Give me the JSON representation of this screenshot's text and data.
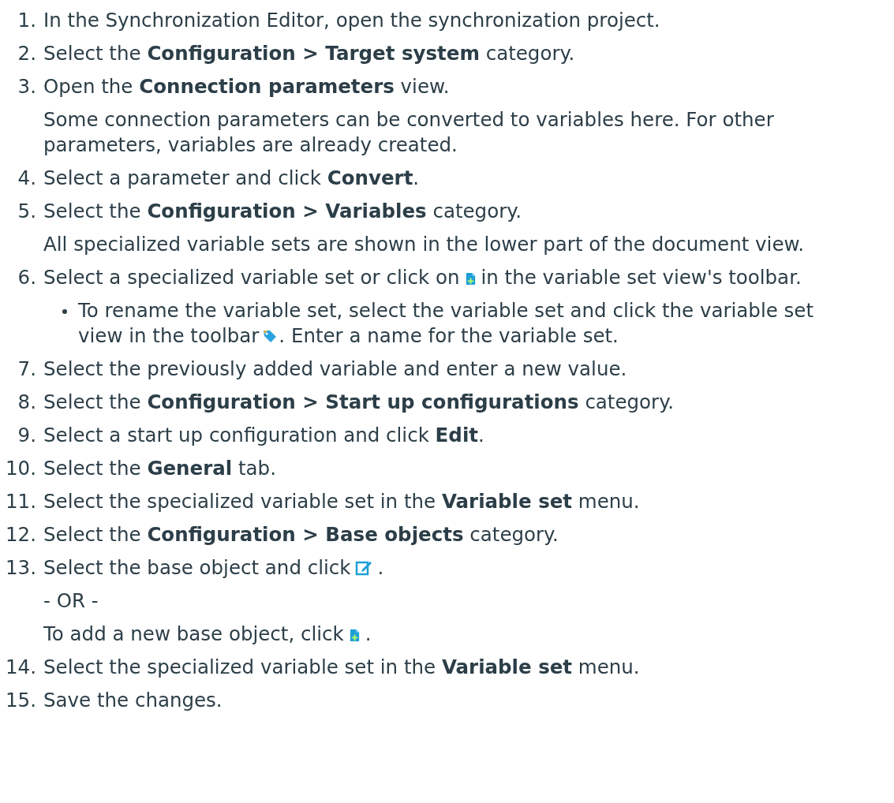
{
  "steps": [
    {
      "number": "1.",
      "parts": [
        {
          "kind": "text",
          "text": "In the Synchronization Editor, open the synchronization project."
        }
      ]
    },
    {
      "number": "2.",
      "parts": [
        {
          "kind": "text",
          "text": "Select the **Configuration > Target system** category."
        }
      ]
    },
    {
      "number": "3.",
      "parts": [
        {
          "kind": "text",
          "text": "Open the **Connection parameters** view."
        }
      ],
      "notes": [
        {
          "kind": "para",
          "parts": [
            {
              "kind": "text",
              "text": "Some connection parameters can be converted to variables here. For other parameters, variables are already created."
            }
          ]
        }
      ]
    },
    {
      "number": "4.",
      "parts": [
        {
          "kind": "text",
          "text": "Select a parameter and click **Convert**."
        }
      ]
    },
    {
      "number": "5.",
      "parts": [
        {
          "kind": "text",
          "text": "Select the **Configuration > Variables** category."
        }
      ],
      "notes": [
        {
          "kind": "para",
          "parts": [
            {
              "kind": "text",
              "text": "All specialized variable sets are shown in the lower part of the document view."
            }
          ]
        }
      ]
    },
    {
      "number": "6.",
      "parts": [
        {
          "kind": "text",
          "text": "Select a specialized variable set or click on"
        },
        {
          "kind": "add"
        },
        {
          "kind": "text",
          "text": "in the variable set view's toolbar."
        }
      ],
      "notes": [
        {
          "kind": "bullet",
          "parts": [
            {
              "kind": "text",
              "text": "To rename the variable set, select the variable set and click the variable set"
            },
            {
              "kind": "break"
            },
            {
              "kind": "text",
              "text": "view in the toolbar"
            },
            {
              "kind": "tag"
            },
            {
              "kind": "text",
              "text": ". Enter a name for the variable set."
            }
          ]
        }
      ]
    },
    {
      "number": "7.",
      "parts": [
        {
          "kind": "text",
          "text": "Select the previously added variable and enter a new value."
        }
      ]
    },
    {
      "number": "8.",
      "parts": [
        {
          "kind": "text",
          "text": "Select the **Configuration > Start up configurations** category."
        }
      ]
    },
    {
      "number": "9.",
      "parts": [
        {
          "kind": "text",
          "text": "Select a start up configuration and click **Edit**."
        }
      ]
    },
    {
      "number": "10.",
      "parts": [
        {
          "kind": "text",
          "text": "Select the **General** tab."
        }
      ]
    },
    {
      "number": "11.",
      "parts": [
        {
          "kind": "text",
          "text": "Select the specialized variable set in the **Variable set** menu."
        }
      ]
    },
    {
      "number": "12.",
      "parts": [
        {
          "kind": "text",
          "text": "Select the **Configuration > Base objects** category."
        }
      ]
    },
    {
      "number": "13.",
      "parts": [
        {
          "kind": "text",
          "text": "Select the base object and click"
        },
        {
          "kind": "edit"
        },
        {
          "kind": "text",
          "text": "."
        }
      ],
      "notes": [
        {
          "kind": "para",
          "parts": [
            {
              "kind": "text",
              "text": "- OR -"
            }
          ]
        },
        {
          "kind": "para",
          "parts": [
            {
              "kind": "text",
              "text": "To add a new base object, click"
            },
            {
              "kind": "add"
            },
            {
              "kind": "text",
              "text": "."
            }
          ]
        }
      ]
    },
    {
      "number": "14.",
      "parts": [
        {
          "kind": "text",
          "text": "Select the specialized variable set in the **Variable set** menu."
        }
      ]
    },
    {
      "number": "15.",
      "parts": [
        {
          "kind": "text",
          "text": "Save the changes."
        }
      ]
    }
  ]
}
